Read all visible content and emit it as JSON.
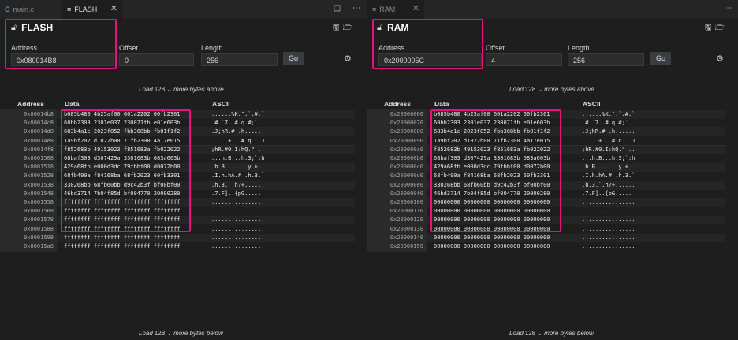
{
  "left": {
    "tabs": [
      {
        "icon": "C",
        "label": "main.c"
      },
      {
        "icon": "≡",
        "label": "FLASH"
      }
    ],
    "title": "FLASH",
    "address_label": "Address",
    "address_value": "0x080014B8",
    "offset_label": "Offset",
    "offset_value": "0",
    "length_label": "Length",
    "length_value": "256",
    "go_label": "Go",
    "load_above": {
      "pre": "Load",
      "count": "128 ⌄",
      "post": "more bytes above"
    },
    "load_below": {
      "pre": "Load",
      "count": "128 ⌄",
      "post": "more bytes below"
    },
    "columns": {
      "address": "Address",
      "data": "Data",
      "ascii": "ASCII"
    },
    "rows": [
      {
        "addr": "0x80014b8",
        "data": "b085b480 4b25af00 601a2202 60fb2301",
        "ascii": "......%K.\".`.#.`"
      },
      {
        "addr": "0x80014c8",
        "data": "60bb2303 2301e037 230071fb e01e603b",
        "ascii": ".#.`7..#.q.#;`.."
      },
      {
        "addr": "0x80014d8",
        "data": "683b4a1e 2023f852 fbb368bb fb01f1f2",
        "ascii": ".J;hR.# .h......"
      },
      {
        "addr": "0x80014e8",
        "data": "1a9bf202 d1022b00 71fb2300 4a17e015",
        "ascii": ".....+...#.q...J"
      },
      {
        "addr": "0x80014f8",
        "data": "f852683b 49153023 f851683a fb022022",
        "ascii": ";hR.#0.I:hQ.\" .."
      },
      {
        "addr": "0x8001508",
        "data": "68baf303 d307429a 3301683b 683a603b",
        "ascii": "...h.B...h.3;`:h"
      },
      {
        "addr": "0x8001518",
        "data": "429a68fb e000d3dc 79fbbf00 d0072b00",
        "ascii": ".h.B.......y.+.."
      },
      {
        "addr": "0x8001528",
        "data": "68fb490a f84168ba 68fb2023 60fb3301",
        "ascii": ".I.h.hA.# .h.3.`"
      },
      {
        "addr": "0x8001538",
        "data": "330268bb 68fb60bb d9c42b3f bf00bf00",
        "ascii": ".h.3.`.h?+......"
      },
      {
        "addr": "0x8001548",
        "data": "46bd3714 7b04f85d bf004770 20000280",
        "ascii": ".7.F]..{pG....."
      },
      {
        "addr": "0x8001558",
        "data": "ffffffff ffffffff ffffffff ffffffff",
        "ascii": "................"
      },
      {
        "addr": "0x8001568",
        "data": "ffffffff ffffffff ffffffff ffffffff",
        "ascii": "................"
      },
      {
        "addr": "0x8001578",
        "data": "ffffffff ffffffff ffffffff ffffffff",
        "ascii": "................"
      },
      {
        "addr": "0x8001588",
        "data": "ffffffff ffffffff ffffffff ffffffff",
        "ascii": "................"
      },
      {
        "addr": "0x8001598",
        "data": "ffffffff ffffffff ffffffff ffffffff",
        "ascii": "................"
      },
      {
        "addr": "0x80015a8",
        "data": "ffffffff ffffffff ffffffff ffffffff",
        "ascii": "................"
      }
    ]
  },
  "right": {
    "tabs": [
      {
        "icon": "≡",
        "label": "RAM"
      }
    ],
    "title": "RAM",
    "address_label": "Address",
    "address_value": "0x2000005C",
    "offset_label": "Offset",
    "offset_value": "4",
    "length_label": "Length",
    "length_value": "256",
    "go_label": "Go",
    "load_above": {
      "pre": "Load",
      "count": "128 ⌄",
      "post": "more bytes above"
    },
    "load_below": {
      "pre": "Load",
      "count": "128 ⌄",
      "post": "more bytes below"
    },
    "columns": {
      "address": "Address",
      "data": "Data",
      "ascii": "ASCII"
    },
    "rows": [
      {
        "addr": "0x20000060",
        "data": "b085b480 4b25af00 601a2202 60fb2301",
        "ascii": "......%K.\".`.#.`"
      },
      {
        "addr": "0x20000070",
        "data": "60bb2303 2301e037 230071fb e01e603b",
        "ascii": ".#.`7..#.q.#;`.."
      },
      {
        "addr": "0x20000080",
        "data": "683b4a1e 2023f852 fbb368bb fb01f1f2",
        "ascii": ".J;hR.# .h......"
      },
      {
        "addr": "0x20000090",
        "data": "1a9bf202 d1022b00 71fb2300 4a17e015",
        "ascii": ".....+...#.q...J"
      },
      {
        "addr": "0x200000a0",
        "data": "f852683b 49153023 f851683a fb022022",
        "ascii": ";hR.#0.I:hQ.\" .."
      },
      {
        "addr": "0x200000b0",
        "data": "68baf303 d307429a 3301683b 683a603b",
        "ascii": "...h.B...h.3;`:h"
      },
      {
        "addr": "0x200000c0",
        "data": "429a68fb e000d3dc 79fbbf00 d0072b00",
        "ascii": ".h.B.......y.+.."
      },
      {
        "addr": "0x200000d0",
        "data": "68fb490a f84168ba 68fb2023 60fb3301",
        "ascii": ".I.h.hA.# .h.3.`"
      },
      {
        "addr": "0x200000e0",
        "data": "330268bb 68fb60bb d9c42b3f bf00bf00",
        "ascii": ".h.3.`.h?+......"
      },
      {
        "addr": "0x200000f0",
        "data": "46bd3714 7b04f85d bf004770 20000280",
        "ascii": ".7.F]..{pG....."
      },
      {
        "addr": "0x20000100",
        "data": "00000000 00000000 00000000 00000000",
        "ascii": "................"
      },
      {
        "addr": "0x20000110",
        "data": "00000000 00000000 00000000 00000000",
        "ascii": "................"
      },
      {
        "addr": "0x20000120",
        "data": "00000000 00000000 00000000 00000000",
        "ascii": "................"
      },
      {
        "addr": "0x20000130",
        "data": "00000000 00000000 00000000 00000000",
        "ascii": "................"
      },
      {
        "addr": "0x20000140",
        "data": "00000000 00000000 00000000 00000000",
        "ascii": "................"
      },
      {
        "addr": "0x20000150",
        "data": "00000000 00000000 00000000 00000000",
        "ascii": "................"
      }
    ]
  },
  "colors": {
    "highlight": "#e5127d",
    "splitter": "#c678dd",
    "background": "#1e1e1e"
  },
  "icons": [
    "c-file-icon",
    "file-lines-icon",
    "close-icon",
    "split-editor-icon",
    "more-icon",
    "lock-icon",
    "save-icon",
    "folder-icon",
    "gear-icon"
  ]
}
